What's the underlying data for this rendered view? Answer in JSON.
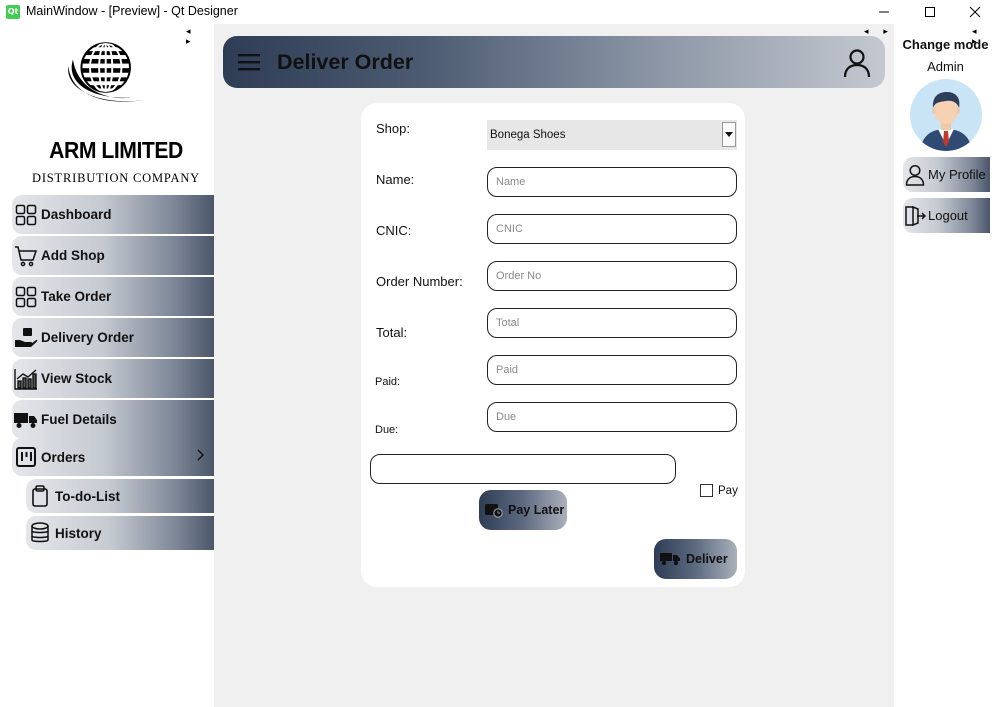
{
  "window": {
    "title": "MainWindow - [Preview] - Qt Designer",
    "app_icon_text": "Qt"
  },
  "splitter": {
    "arrows": "◂ ▸"
  },
  "brand": {
    "name": "ARM LIMITED",
    "tagline": "DISTRIBUTION COMPANY"
  },
  "sidebar": {
    "items": [
      {
        "label": "Dashboard",
        "icon": "dashboard-grid-icon"
      },
      {
        "label": "Add Shop",
        "icon": "cart-icon"
      },
      {
        "label": "Take Order",
        "icon": "grid-icon"
      },
      {
        "label": "Delivery Order",
        "icon": "hand-box-icon"
      },
      {
        "label": "View Stock",
        "icon": "stock-chart-icon"
      },
      {
        "label": "Fuel Details",
        "icon": "truck-icon"
      },
      {
        "label": "Orders",
        "icon": "board-icon"
      }
    ],
    "sub_items": [
      {
        "label": "To-do-List",
        "icon": "clipboard-icon"
      },
      {
        "label": "History",
        "icon": "database-icon"
      }
    ]
  },
  "header": {
    "title": "Deliver Order"
  },
  "form": {
    "shop_label": "Shop:",
    "shop_value": "Bonega Shoes",
    "name_label": "Name:",
    "name_placeholder": "Name",
    "cnic_label": "CNIC:",
    "cnic_placeholder": "CNIC",
    "order_label": "Order Number:",
    "order_placeholder": "Order No",
    "total_label": "Total:",
    "total_placeholder": "Total",
    "paid_label": "Paid:",
    "paid_placeholder": "Paid",
    "due_label": "Due:",
    "due_placeholder": "Due",
    "pay_label": "Pay",
    "pay_checked": false,
    "pay_later_label": "Pay Later",
    "deliver_label": "Deliver"
  },
  "right_panel": {
    "mode_label": "Change mode",
    "role": "Admin",
    "profile_label": "My Profile",
    "logout_label": "Logout"
  },
  "colors": {
    "header_dark": "#2e3d55",
    "header_light": "#c4c9d0",
    "main_bg": "#f0f0f0",
    "avatar_bg": "#c9e4f4"
  }
}
